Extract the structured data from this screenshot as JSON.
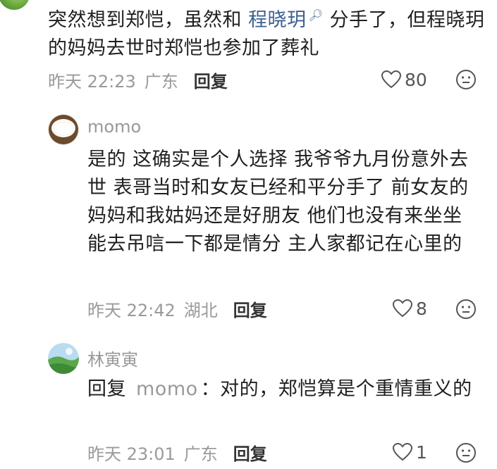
{
  "comments": [
    {
      "text_before": "突然想到郑恺，虽然和 ",
      "mention": "程晓玥",
      "text_after": " 分手了，但程晓玥的妈妈去世时郑恺也参加了葬礼",
      "time": "昨天 22:23",
      "location": "广东",
      "reply_label": "回复",
      "likes": "80"
    },
    {
      "username": "momo",
      "text": "是的 这确实是个人选择 我爷爷九月份意外去世 表哥当时和女友已经和平分手了 前女友的妈妈和我姑妈还是好朋友 他们也没有来坐坐 能去吊唁一下都是情分 主人家都记在心里的",
      "time": "昨天 22:42",
      "location": "湖北",
      "reply_label": "回复",
      "likes": "8"
    },
    {
      "username": "林寅寅",
      "reply_prefix": "回复",
      "reply_to": "momo",
      "text": "：对的，郑恺算是个重情重义的",
      "time": "昨天 23:01",
      "location": "广东",
      "reply_label": "回复",
      "likes": "1"
    }
  ],
  "icons": {
    "like": "heart-outline-icon",
    "emoji": "emoji-face-icon",
    "mention": "search-icon"
  }
}
